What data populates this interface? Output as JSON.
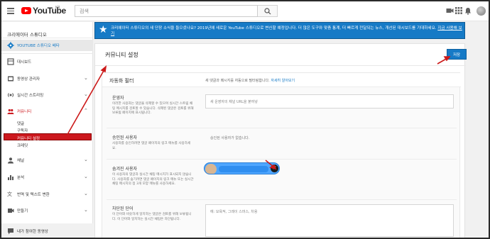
{
  "topbar": {
    "logo_text": "YouTube",
    "logo_region": "KR",
    "search_placeholder": "검색",
    "icons": [
      "menu-icon",
      "search-icon",
      "video-camera-icon",
      "apps-grid-icon",
      "notifications-bell-icon",
      "account-avatar"
    ]
  },
  "sidebar": {
    "title": "크리에이터 스튜디오",
    "items": [
      {
        "label": "YOUTUBE 스튜디오 베타",
        "icon": "gear-icon",
        "state": "selected"
      },
      {
        "label": "대시보드",
        "icon": "dashboard-icon"
      },
      {
        "label": "동영상 관리자",
        "icon": "video-manager-icon",
        "chevron": "⌄"
      },
      {
        "label": "실시간 스트리밍",
        "icon": "live-stream-icon",
        "chevron": "⌄"
      },
      {
        "label": "커뮤니티",
        "icon": "community-icon",
        "chevron": "⌃",
        "state": "open"
      },
      {
        "label": "채널",
        "icon": "channel-icon",
        "chevron": "⌄"
      },
      {
        "label": "분석",
        "icon": "analytics-icon",
        "chevron": "⌄"
      },
      {
        "label": "번역 및 텍스트 변환",
        "icon": "translate-icon",
        "chevron": "⌄"
      },
      {
        "label": "만들기",
        "icon": "create-icon",
        "chevron": "⌄"
      }
    ],
    "community_sub": [
      "댓글",
      "구독자",
      "커뮤니티 설정",
      "크레딧"
    ],
    "community_sub_active": "커뮤니티 설정",
    "bottom_item": "내가 참여한 동영상"
  },
  "banner": {
    "text": "크리에이터 스튜디오의 새 단장 소식을 들으셨나요? 2019년에 새로운 YouTube 스튜디오로 변신할 예정입니다. 더 많은 도구와 맞춤 통계, 더 빠르게 전달되는 뉴스, 개선된 대시보드를 기대하세요.",
    "link": "지금 사용해 보기"
  },
  "main": {
    "title": "커뮤니티 설정",
    "save_label": "저장",
    "filter_section": {
      "title": "자동화 필터",
      "description": "새 댓글과 메시지를 자동으로 필터링합니다.",
      "learn_more": "자세히 알아보기"
    },
    "moderators": {
      "label": "운영자",
      "desc": "이러한 사용자는 댓글을 삭제할 수 있으며 실시간 스트림 채팅 메시지를 검토할 수 있습니다. 삭제된 댓글은 검토를 위해 보류됨 페이지에 표시됩니다.",
      "placeholder": "새 운영자의 채널 URL을 붙여넣"
    },
    "approved": {
      "label": "승인된 사용자",
      "desc": "사용자를 승인하려면 댓글 페이지의 링크 메뉴를 사용하세요.",
      "empty": "승인된 사용자가 없습니다."
    },
    "hidden": {
      "label": "숨겨진 사용자",
      "desc": "이 사용자의 댓글과 실시간 채팅 메시지가 표시되지 않습니다. 사용자를 숨기려면 댓글 페이지의 링크 메뉴 또는 실시간 채팅 메시지의 점 3개 모양 메뉴를 사용하세요.",
      "chip_remove_glyph": "✕"
    },
    "blocked_words": {
      "label": "차단된 단어",
      "desc": "이 단어와 비슷하게 일치하는 댓글은 검토를 위해 보류됩니다. 이 단어와 일치하는 실시간 채팅은 차단됩니다.",
      "placeholder": "예: 모욕적, 그레이 스머스, 차용"
    }
  },
  "colors": {
    "accent": "#167ac6",
    "brand_red": "#cc181e",
    "annotation_arrow": "#cc1a1a"
  }
}
